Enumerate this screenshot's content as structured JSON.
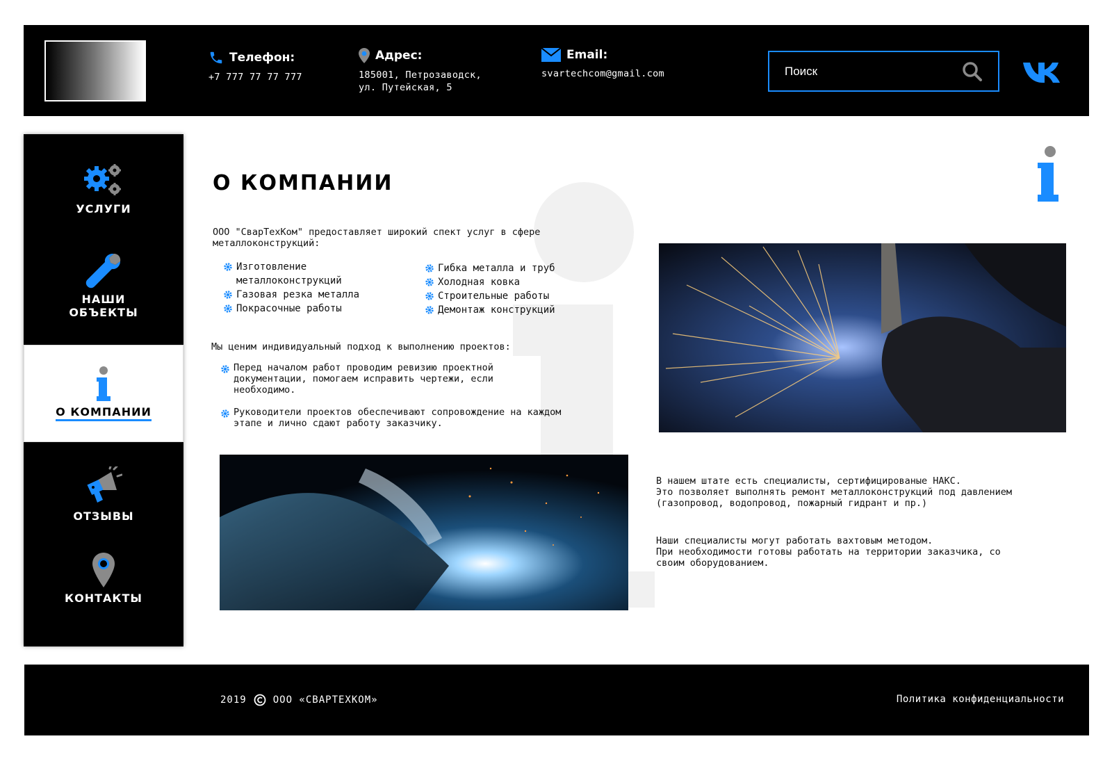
{
  "header": {
    "phone": {
      "label": "Телефон:",
      "value": "+7 777 77 77 777"
    },
    "address": {
      "label": "Адрес:",
      "line1": "185001, Петрозаводск,",
      "line2": "ул. Путейская, 5"
    },
    "email": {
      "label": "Email:",
      "value": "svartechcom@gmail.com"
    },
    "search": {
      "placeholder": "Поиск"
    }
  },
  "sidebar": {
    "items": [
      {
        "label": "УСЛУГИ",
        "icon": "gears-icon"
      },
      {
        "label1": "НАШИ",
        "label2": "ОБЪЕКТЫ",
        "icon": "wrench-icon"
      },
      {
        "label": "О КОМПАНИИ",
        "icon": "info-icon",
        "active": true
      },
      {
        "label": "ОТЗЫВЫ",
        "icon": "megaphone-icon"
      },
      {
        "label": "КОНТАКТЫ",
        "icon": "location-pin-icon"
      }
    ]
  },
  "main": {
    "title": "О КОМПАНИИ",
    "intro_line1": "ООО \"СварТехКом\" предоставляет широкий спект услуг в сфере",
    "intro_line2": "металлоконструкций:",
    "services_left": [
      "Изготовление металлоконструкций",
      "Газовая резка металла",
      "Покрасочные работы"
    ],
    "services_right": [
      "Гибка металла и труб",
      "Холодная ковка",
      "Строительные работы",
      "Демонтаж конструкций"
    ],
    "approach_heading": "Мы ценим индивидуальный подход к выполнению проектов:",
    "approach": [
      "Перед началом работ проводим ревизию проектной документации, помогаем исправить чертежи, если необходимо.",
      "Руководители проектов обеспечивают сопровождение на каждом этапе и лично сдают работу заказчику."
    ],
    "naks_line1": "В нашем штате есть специалисты, сертифицированые НАКС.",
    "naks_line2": "Это позволяет выполнять ремонт металлоконструкций под давлением",
    "naks_line3": "(газопровод, водопровод, пожарный гидрант и пр.)",
    "shift_line1": "Наши специалисты могут работать вахтовым методом.",
    "shift_line2": "При необходимости готовы работать на территории заказчика, со",
    "shift_line3": "своим оборудованием."
  },
  "footer": {
    "year": "2019",
    "company": "ООО «СВАРТЕХКОМ»",
    "policy": "Политика конфиденциальности"
  },
  "colors": {
    "accent": "#1a8cff",
    "dark": "#000000",
    "icon_gray": "#8a8a8a"
  }
}
